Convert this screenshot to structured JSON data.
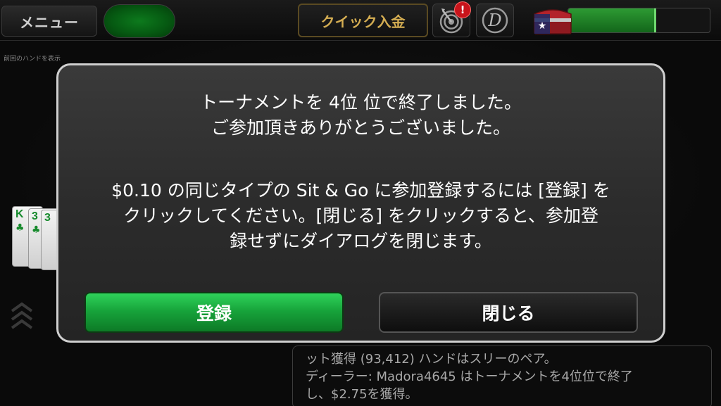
{
  "topbar": {
    "menu_label": "メニュー",
    "deposit_label": "クイック入金",
    "notification_count": "!",
    "d_icon_glyph": "D",
    "progress_fraction": 0.62,
    "status_color": "#0d7a1d"
  },
  "table": {
    "prev_hand_label": "前回のハンドを表示",
    "cards": [
      {
        "rank": "K",
        "suit": "♣"
      },
      {
        "rank": "3",
        "suit": "♣"
      },
      {
        "rank": "3",
        "suit": "♣"
      }
    ]
  },
  "dialog": {
    "line1": "トーナメントを 4位 位で終了しました。",
    "line2": "ご参加頂きありがとうございました。",
    "line3": "$0.10 の同じタイプの Sit & Go に参加登録するには [登録] を",
    "line4": "クリックしてください。[閉じる] をクリックすると、参加登",
    "line5": "録せずにダイアログを閉じます。",
    "register_label": "登録",
    "close_label": "閉じる"
  },
  "log": {
    "line1": "ット獲得 (93,412)  ハンドはスリーのペア。",
    "line2": "ディーラー: Madora4645 はトーナメントを4位位で終了",
    "line3": "し、$2.75を獲得。"
  },
  "colors": {
    "accent_gold": "#d4ad52",
    "register_green": "#17a43b",
    "alert_red": "#c8141b",
    "card_suit_green": "#168a2c"
  }
}
